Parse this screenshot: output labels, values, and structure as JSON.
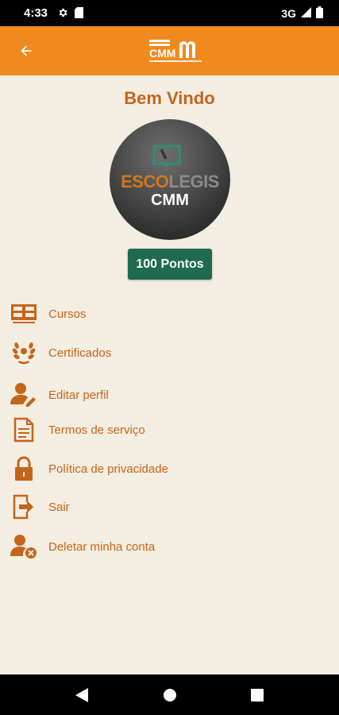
{
  "status_bar": {
    "time": "4:33",
    "network": "3G"
  },
  "app_bar": {
    "back_icon": "arrow-left-icon",
    "logo": "escolegis-cmm-logo"
  },
  "profile": {
    "welcome": "Bem Vindo",
    "avatar_title_part1": "ESCO",
    "avatar_title_part2": "LEGIS",
    "avatar_subtitle": "CMM",
    "points": "100 Pontos"
  },
  "menu": {
    "items": [
      {
        "label": "Cursos",
        "icon": "courses-grid-icon"
      },
      {
        "label": "Certificados",
        "icon": "laurel-icon"
      },
      {
        "label": "Editar perfil",
        "icon": "user-edit-icon"
      },
      {
        "label": "Termos de serviço",
        "icon": "document-icon"
      },
      {
        "label": "Política de privacidade",
        "icon": "lock-icon"
      },
      {
        "label": "Sair",
        "icon": "logout-icon"
      },
      {
        "label": "Deletar minha conta",
        "icon": "user-delete-icon"
      }
    ]
  },
  "colors": {
    "app_bar": "#f08a1f",
    "background": "#f4ede1",
    "accent": "#c4651b",
    "points_badge": "#1f6b4f"
  }
}
